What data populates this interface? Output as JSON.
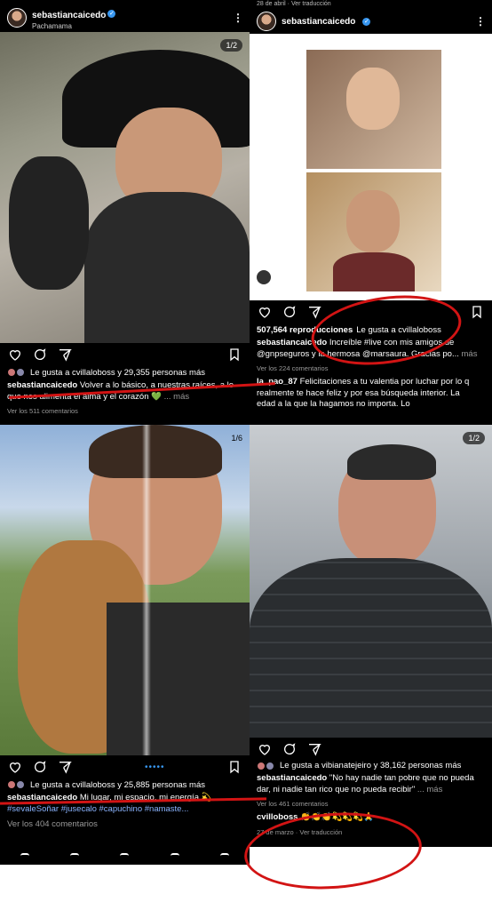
{
  "colors": {
    "verified": "#3897f0",
    "annotation": "#d21414",
    "background": "#000000"
  },
  "post_tl": {
    "username": "sebastiancaicedo",
    "location": "Pachamama",
    "counter": "1/2",
    "likes": "Le gusta a cvillaloboss y 29,355 personas más",
    "caption_user": "sebastiancaicedo",
    "caption_text": "Volver a lo básico, a nuestras raíces, a lo que nos alimenta el alma y el corazón 💚",
    "more": "... más",
    "comments": "Ver los 511 comentarios"
  },
  "post_tr": {
    "top_date": "28 de abril",
    "top_translate": "Ver traducción",
    "username": "sebastiancaicedo",
    "views": "507,564 reproducciones",
    "liked_by": "Le gusta a cvillaloboss",
    "caption_user": "sebastiancaicedo",
    "caption_text": "Increíble #live con mis amigos de @gnpseguros y la hermosa @marsaura. Gracias po...",
    "more": "más",
    "comments": "Ver los 224 comentarios",
    "comment_user": "la_pao_87",
    "comment_text": "Felicitaciones a tu valentia por luchar por lo q realmente te hace feliz y por esa búsqueda interior. La edad a la que la hagamos no importa. Lo"
  },
  "post_bl": {
    "counter": "1/6",
    "likes": "Le gusta a cvillaloboss y 25,885 personas más",
    "caption_user": "sebastiancaicedo",
    "caption_text": "Mi lugar, mi espacio, mi energía 💫",
    "hashtags": "#sevaleSoñar #jusecalo #capuchino #namaste...",
    "comments": "Ver los 404 comentarios"
  },
  "post_br": {
    "counter": "1/2",
    "likes": "Le gusta a vibianatejeiro y 38,162 personas más",
    "caption_user": "sebastiancaicedo",
    "caption_text": "\"No hay nadie tan pobre que no pueda dar, ni nadie tan rico que no pueda recibir\"",
    "more": "... más",
    "comments": "Ver los 461 comentarios",
    "comment_user": "cvilloboss",
    "comment_text": "👏👏👏💫💫💫🙏",
    "date": "27 de marzo",
    "translate": "Ver traducción"
  },
  "icons": [
    "heart-icon",
    "comment-icon",
    "share-icon",
    "bookmark-icon",
    "verified-icon",
    "more-icon"
  ]
}
